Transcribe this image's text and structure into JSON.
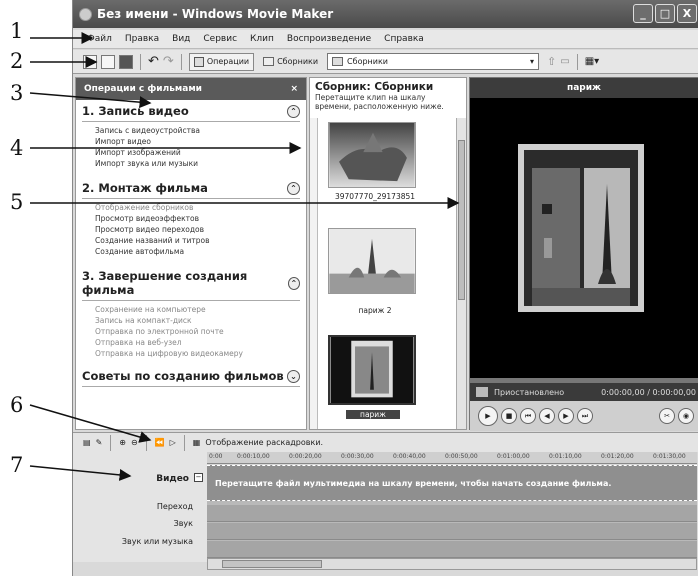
{
  "callouts": [
    "1",
    "2",
    "3",
    "4",
    "5",
    "6",
    "7"
  ],
  "window": {
    "title": "Без имени - Windows Movie Maker",
    "buttons": [
      "_",
      "□",
      "X"
    ]
  },
  "menu": [
    "Файл",
    "Правка",
    "Вид",
    "Сервис",
    "Клип",
    "Воспроизведение",
    "Справка"
  ],
  "toolbar": {
    "operations_label": "Операции",
    "collections_label": "Сборники",
    "collection_select": "Сборники"
  },
  "tasks": {
    "header": "Операции с фильмами",
    "close": "×",
    "sections": [
      {
        "title": "1. Запись видео",
        "toggle": "⌃",
        "items": [
          "Запись с видеоустройства",
          "Импорт видео",
          "Импорт изображений",
          "Импорт звука или музыки"
        ]
      },
      {
        "title": "2. Монтаж фильма",
        "toggle": "⌃",
        "items": [
          "Отображение сборников",
          "Просмотр видеоэффектов",
          "Просмотр видео переходов",
          "Создание названий и титров",
          "Создание автофильма"
        ]
      },
      {
        "title": "3. Завершение создания фильма",
        "toggle": "⌃",
        "items": [
          "Сохранение на компьютере",
          "Запись на компакт-диск",
          "Отправка по электронной почте",
          "Отправка на веб-узел",
          "Отправка на цифровую видеокамеру"
        ]
      },
      {
        "title": "Советы по созданию фильмов",
        "toggle": "⌄",
        "items": []
      }
    ]
  },
  "collection": {
    "title": "Сборник: Сборники",
    "subtitle": "Перетащите клип на шкалу времени, расположенную ниже.",
    "clips": [
      "39707770_29173851",
      "париж 2",
      "париж"
    ]
  },
  "monitor": {
    "title": "париж",
    "status": "Приостановлено",
    "time": "0:00:00,00 / 0:00:00,00"
  },
  "timeline": {
    "storyboard_label": "Отображение раскадровки.",
    "ruler": [
      "0:00",
      "0:00:10,00",
      "0:00:20,00",
      "0:00:30,00",
      "0:00:40,00",
      "0:00:50,00",
      "0:01:00,00",
      "0:01:10,00",
      "0:01:20,00",
      "0:01:30,00"
    ],
    "tracks": {
      "video": "Видео",
      "transition": "Переход",
      "audio": "Звук",
      "music": "Звук или музыка"
    },
    "video_hint": "Перетащите файл мультимедиа на шкалу времени, чтобы начать создание фильма."
  },
  "colors": {
    "title_bar": "#4a4a4a",
    "monitor_bg": "#000000",
    "video_track": "#8f8f8f"
  }
}
